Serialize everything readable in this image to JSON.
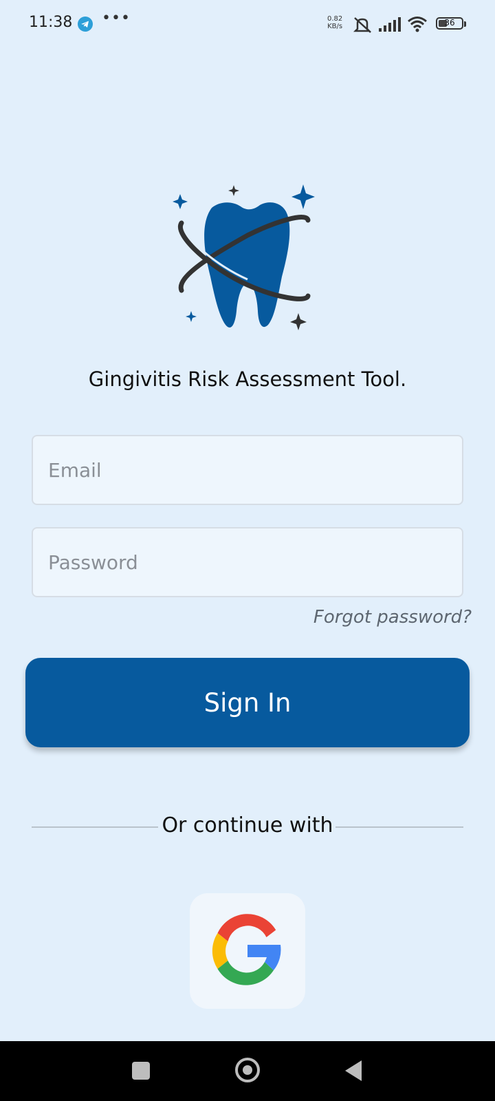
{
  "status_bar": {
    "time": "11:38",
    "net_speed_value": "0.82",
    "net_speed_unit": "KB/s",
    "battery": "36",
    "battery_level": 0.36,
    "icons": [
      "telegram-icon",
      "more-dots-icon",
      "mute-icon",
      "signal-icon",
      "wifi-icon",
      "battery-icon"
    ]
  },
  "app": {
    "title": "Gingivitis Risk Assessment Tool.",
    "brand_color": "#075a9e"
  },
  "login": {
    "email_placeholder": "Email",
    "email_value": "",
    "password_placeholder": "Password",
    "password_value": "",
    "forgot_label": "Forgot password?",
    "sign_in_label": "Sign In",
    "divider_label": "Or continue with"
  },
  "nav": {
    "icons": [
      "recent-apps-icon",
      "home-icon",
      "back-icon"
    ]
  }
}
